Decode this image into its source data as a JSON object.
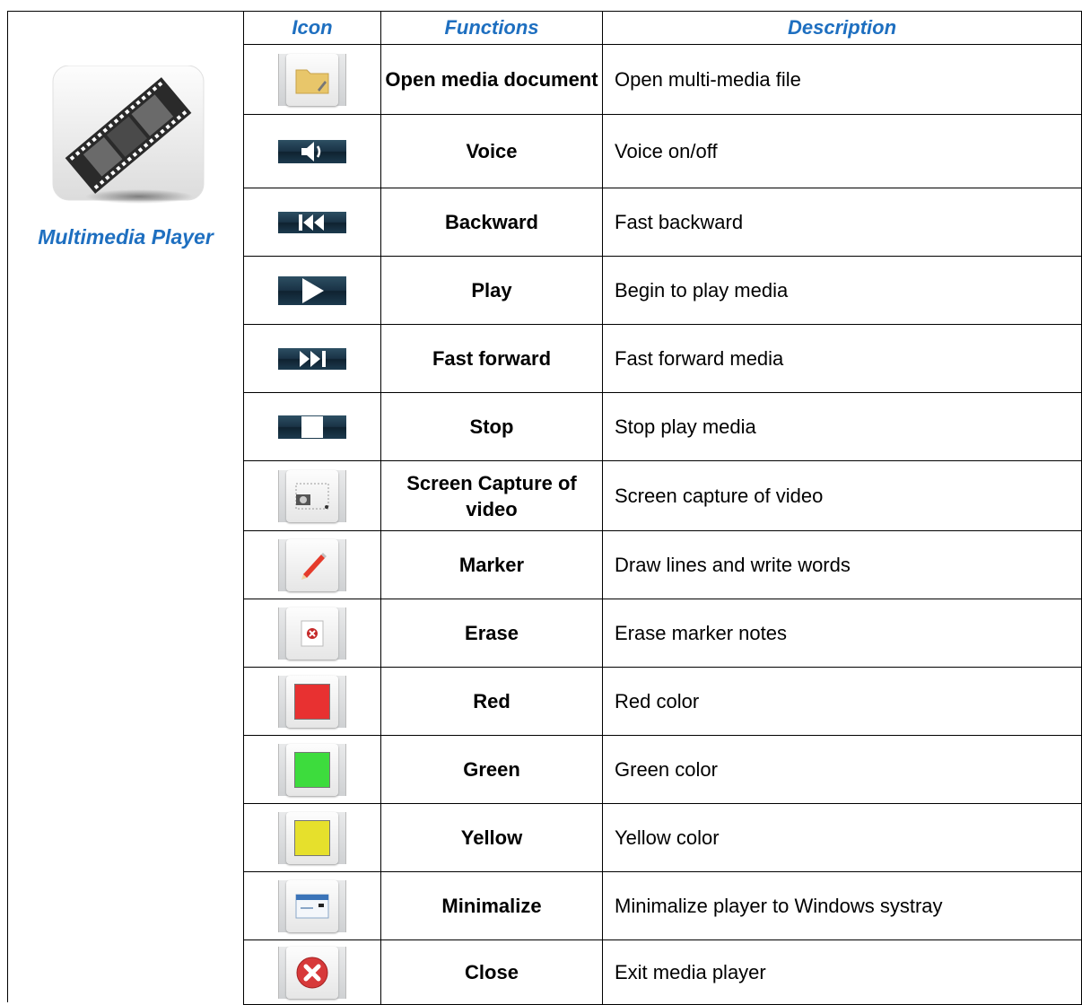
{
  "app": {
    "title": "Multimedia Player"
  },
  "headers": {
    "icon": "Icon",
    "functions": "Functions",
    "description": "Description"
  },
  "rows": [
    {
      "icon": "folder-icon",
      "function": "Open media document",
      "description": "Open multi-media file"
    },
    {
      "icon": "speaker-icon",
      "function": "Voice",
      "description": "Voice on/off"
    },
    {
      "icon": "skip-back-icon",
      "function": "Backward",
      "description": "Fast backward"
    },
    {
      "icon": "play-icon",
      "function": "Play",
      "description": "Begin to play media"
    },
    {
      "icon": "skip-forward-icon",
      "function": "Fast forward",
      "description": "Fast forward media"
    },
    {
      "icon": "stop-icon",
      "function": "Stop",
      "description": "Stop play media"
    },
    {
      "icon": "camera-icon",
      "function": "Screen Capture of video",
      "description": "Screen capture of video"
    },
    {
      "icon": "pencil-icon",
      "function": "Marker",
      "description": "Draw lines and write words"
    },
    {
      "icon": "eraser-icon",
      "function": "Erase",
      "description": "Erase marker notes"
    },
    {
      "icon": "red-swatch-icon",
      "function": "Red",
      "description": "Red color",
      "color": "#e83131"
    },
    {
      "icon": "green-swatch-icon",
      "function": "Green",
      "description": "Green color",
      "color": "#3ddc3d"
    },
    {
      "icon": "yellow-swatch-icon",
      "function": "Yellow",
      "description": "Yellow color",
      "color": "#e6e02c"
    },
    {
      "icon": "minimize-icon",
      "function": "Minimalize",
      "description": "Minimalize player to Windows systray"
    },
    {
      "icon": "close-icon",
      "function": "Close",
      "description": "Exit media player"
    }
  ],
  "colors": {
    "accent": "#1e6fc0"
  }
}
